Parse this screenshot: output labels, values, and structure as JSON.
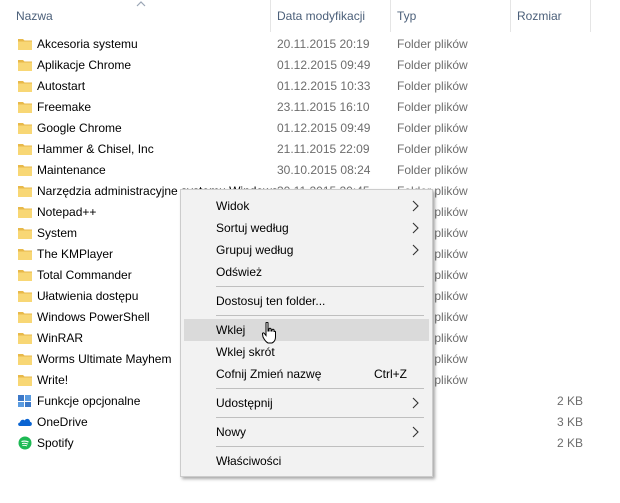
{
  "columns": {
    "name": "Nazwa",
    "modified": "Data modyfikacji",
    "type": "Typ",
    "size": "Rozmiar"
  },
  "files": [
    {
      "name": "Akcesoria systemu",
      "date": "20.11.2015 20:19",
      "type": "Folder plików",
      "size": "",
      "icon": "folder-icon"
    },
    {
      "name": "Aplikacje Chrome",
      "date": "01.12.2015 09:49",
      "type": "Folder plików",
      "size": "",
      "icon": "folder-icon"
    },
    {
      "name": "Autostart",
      "date": "01.12.2015 10:33",
      "type": "Folder plików",
      "size": "",
      "icon": "folder-icon"
    },
    {
      "name": "Freemake",
      "date": "23.11.2015 16:10",
      "type": "Folder plików",
      "size": "",
      "icon": "folder-icon"
    },
    {
      "name": "Google Chrome",
      "date": "01.12.2015 09:49",
      "type": "Folder plików",
      "size": "",
      "icon": "folder-icon"
    },
    {
      "name": "Hammer & Chisel, Inc",
      "date": "21.11.2015 22:09",
      "type": "Folder plików",
      "size": "",
      "icon": "folder-icon"
    },
    {
      "name": "Maintenance",
      "date": "30.10.2015 08:24",
      "type": "Folder plików",
      "size": "",
      "icon": "folder-icon"
    },
    {
      "name": "Narzędzia administracyjne systemu Windows",
      "date": "30.11.2015 20:45",
      "type": "Folder plików",
      "size": "",
      "icon": "folder-icon"
    },
    {
      "name": "Notepad++",
      "date": "",
      "type": "Folder plików",
      "size": "",
      "icon": "folder-icon"
    },
    {
      "name": "System",
      "date": "",
      "type": "Folder plików",
      "size": "",
      "icon": "folder-icon"
    },
    {
      "name": "The KMPlayer",
      "date": "",
      "type": "Folder plików",
      "size": "",
      "icon": "folder-icon"
    },
    {
      "name": "Total Commander",
      "date": "",
      "type": "Folder plików",
      "size": "",
      "icon": "folder-icon"
    },
    {
      "name": "Ułatwienia dostępu",
      "date": "",
      "type": "Folder plików",
      "size": "",
      "icon": "folder-icon"
    },
    {
      "name": "Windows PowerShell",
      "date": "",
      "type": "Folder plików",
      "size": "",
      "icon": "folder-icon"
    },
    {
      "name": "WinRAR",
      "date": "",
      "type": "Folder plików",
      "size": "",
      "icon": "folder-icon"
    },
    {
      "name": "Worms Ultimate Mayhem",
      "date": "",
      "type": "Folder plików",
      "size": "",
      "icon": "folder-icon"
    },
    {
      "name": "Write!",
      "date": "",
      "type": "Folder plików",
      "size": "",
      "icon": "folder-icon"
    },
    {
      "name": "Funkcje opcjonalne",
      "date": "",
      "type": "",
      "size": "2 KB",
      "icon": "shortcut-icon"
    },
    {
      "name": "OneDrive",
      "date": "",
      "type": "",
      "size": "3 KB",
      "icon": "onedrive-icon"
    },
    {
      "name": "Spotify",
      "date": "",
      "type": "",
      "size": "2 KB",
      "icon": "spotify-icon"
    }
  ],
  "context_menu": {
    "items": [
      {
        "label": "Widok",
        "shortcut": "",
        "submenu": true
      },
      {
        "label": "Sortuj według",
        "shortcut": "",
        "submenu": true
      },
      {
        "label": "Grupuj według",
        "shortcut": "",
        "submenu": true
      },
      {
        "label": "Odśwież",
        "shortcut": "",
        "submenu": false
      },
      {
        "label": "Dostosuj ten folder...",
        "shortcut": "",
        "submenu": false
      },
      {
        "label": "Wklej",
        "shortcut": "",
        "submenu": false,
        "hovered": true
      },
      {
        "label": "Wklej skrót",
        "shortcut": "",
        "submenu": false
      },
      {
        "label": "Cofnij Zmień nazwę",
        "shortcut": "Ctrl+Z",
        "submenu": false
      },
      {
        "label": "Udostępnij",
        "shortcut": "",
        "submenu": true
      },
      {
        "label": "Nowy",
        "shortcut": "",
        "submenu": true
      },
      {
        "label": "Właściwości",
        "shortcut": "",
        "submenu": false
      }
    ]
  },
  "colors": {
    "folder": "#f8d775",
    "folder_dark": "#e8b94a",
    "header_text": "#4c607a",
    "menu_bg": "#f2f2f2",
    "menu_hover": "#dadada",
    "onedrive": "#0a64d2",
    "spotify": "#1db954"
  }
}
